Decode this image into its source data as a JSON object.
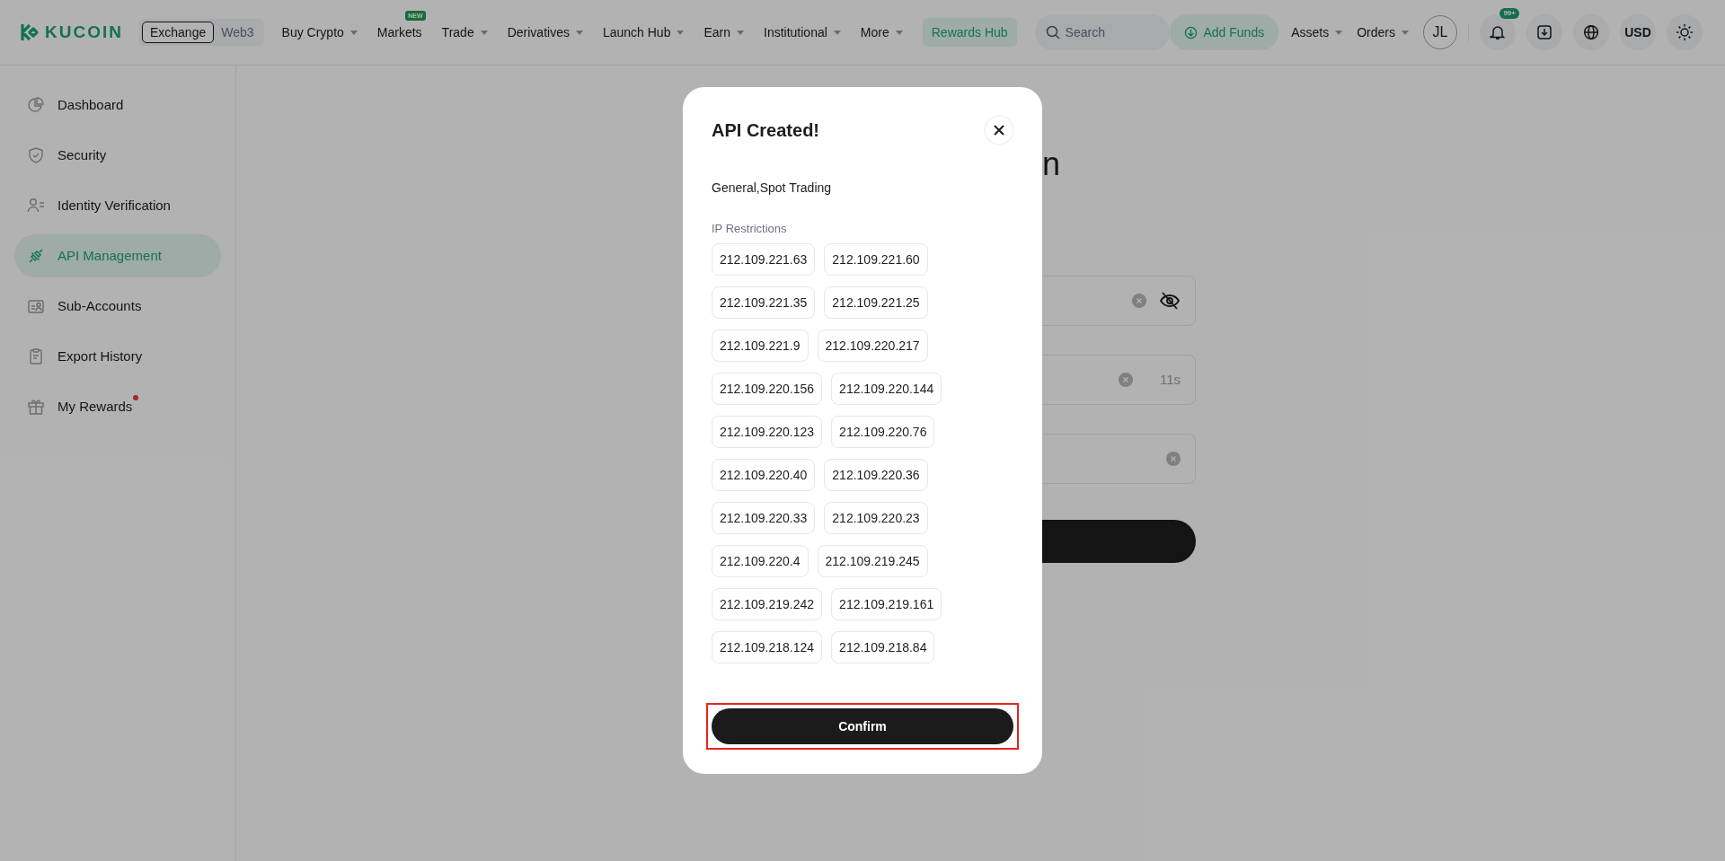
{
  "header": {
    "logo": "KUCOIN",
    "mode_toggle": [
      {
        "label": "Exchange",
        "selected": true
      },
      {
        "label": "Web3",
        "selected": false
      }
    ],
    "nav": [
      {
        "label": "Buy Crypto",
        "kind": "dropdown"
      },
      {
        "label": "Markets",
        "kind": "link",
        "badge": "NEW"
      },
      {
        "label": "Trade",
        "kind": "dropdown"
      },
      {
        "label": "Derivatives",
        "kind": "dropdown"
      },
      {
        "label": "Launch Hub",
        "kind": "dropdown"
      },
      {
        "label": "Earn",
        "kind": "dropdown"
      },
      {
        "label": "Institutional",
        "kind": "dropdown"
      },
      {
        "label": "More",
        "kind": "dropdown"
      },
      {
        "label": "Rewards Hub",
        "kind": "highlight"
      }
    ],
    "search": {
      "placeholder": "Search"
    },
    "add_funds": "Add Funds",
    "menus": [
      "Assets",
      "Orders"
    ],
    "avatar": "JL",
    "notifications_badge": "99+",
    "currency": "USD"
  },
  "sidebar": {
    "items": [
      {
        "label": "Dashboard",
        "selected": false
      },
      {
        "label": "Security",
        "selected": false
      },
      {
        "label": "Identity Verification",
        "selected": false
      },
      {
        "label": "API Management",
        "selected": true
      },
      {
        "label": "Sub-Accounts",
        "selected": false
      },
      {
        "label": "Export History",
        "selected": false
      },
      {
        "label": "My Rewards",
        "selected": false,
        "dot": true
      }
    ]
  },
  "background_form": {
    "heading": "n",
    "fields": [
      {
        "kind": "secret"
      },
      {
        "kind": "code",
        "timer": "11s"
      },
      {
        "kind": "plain"
      }
    ]
  },
  "dialog": {
    "title": "API Created!",
    "permissions": "General,Spot Trading",
    "ip_label": "IP Restrictions",
    "ips": [
      "212.109.221.63",
      "212.109.221.60",
      "212.109.221.35",
      "212.109.221.25",
      "212.109.221.9",
      "212.109.220.217",
      "212.109.220.156",
      "212.109.220.144",
      "212.109.220.123",
      "212.109.220.76",
      "212.109.220.40",
      "212.109.220.36",
      "212.109.220.33",
      "212.109.220.23",
      "212.109.220.4",
      "212.109.219.245",
      "212.109.219.242",
      "212.109.219.161",
      "212.109.218.124",
      "212.109.218.84"
    ],
    "confirm": "Confirm",
    "confirm_highlighted": true
  }
}
